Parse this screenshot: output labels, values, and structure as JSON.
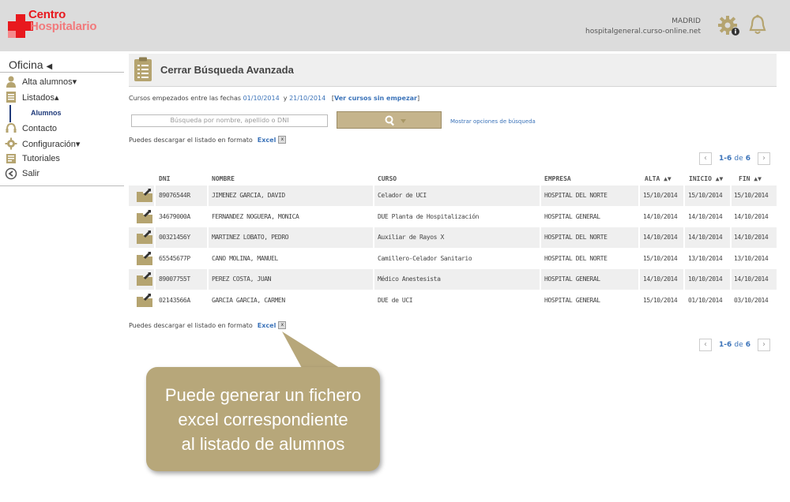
{
  "header": {
    "logo_line1": "Centro",
    "logo_line2": "Hospitalario",
    "city": "MADRID",
    "host": "hospitalgeneral.curso-online.net"
  },
  "sidebar": {
    "title": "Oficina",
    "title_arrow": "◀",
    "items": [
      {
        "label": "Alta alumnos▾",
        "icon": "user-icon"
      },
      {
        "label": "Listados▴",
        "icon": "list-icon"
      },
      {
        "label": "Contacto",
        "icon": "headset-icon"
      },
      {
        "label": "Configuración▾",
        "icon": "gear-icon"
      },
      {
        "label": "Tutoriales",
        "icon": "book-icon"
      },
      {
        "label": "Salir",
        "icon": "exit-icon"
      }
    ],
    "sub_item": "Alumnos"
  },
  "main": {
    "title": "Cerrar Búsqueda Avanzada",
    "dates": {
      "prefix": "Cursos empezados entre las fechas",
      "from": "01/10/2014",
      "and": "y",
      "to": "21/10/2014",
      "bracket_open": "[",
      "link": "Ver cursos sin empezar",
      "bracket_close": "]"
    },
    "search_placeholder": "Búsqueda por nombre, apellido o DNI",
    "search_options": "Mostrar opciones de búsqueda",
    "download_text": "Puedes descargar el listado en formato",
    "excel": "Excel",
    "pager": {
      "range": "1-6",
      "de": "de",
      "total": "6",
      "prev": "‹",
      "next": "›"
    }
  },
  "table": {
    "headers": {
      "dni": "DNI",
      "nombre": "NOMBRE",
      "curso": "CURSO",
      "empresa": "EMPRESA",
      "alta": "ALTA ▲▼",
      "inicio": "INICIO ▲▼",
      "fin": "FIN ▲▼"
    },
    "rows": [
      {
        "dni": "89076544R",
        "nombre": "JIMENEZ GARCIA, DAVID",
        "curso": "Celador de UCI",
        "empresa": "HOSPITAL DEL NORTE",
        "alta": "15/10/2014",
        "inicio": "15/10/2014",
        "fin": "15/10/2014"
      },
      {
        "dni": "34679000A",
        "nombre": "FERNANDEZ NOGUERA, MONICA",
        "curso": "DUE Planta de Hospitalización",
        "empresa": "HOSPITAL GENERAL",
        "alta": "14/10/2014",
        "inicio": "14/10/2014",
        "fin": "14/10/2014"
      },
      {
        "dni": "00321456Y",
        "nombre": "MARTINEZ LOBATO, PEDRO",
        "curso": "Auxiliar de Rayos X",
        "empresa": "HOSPITAL DEL NORTE",
        "alta": "14/10/2014",
        "inicio": "14/10/2014",
        "fin": "14/10/2014"
      },
      {
        "dni": "65545677P",
        "nombre": "CANO MOLINA, MANUEL",
        "curso": "Camillero-Celador Sanitario",
        "empresa": "HOSPITAL DEL NORTE",
        "alta": "15/10/2014",
        "inicio": "13/10/2014",
        "fin": "13/10/2014"
      },
      {
        "dni": "89007755T",
        "nombre": "PEREZ COSTA, JUAN",
        "curso": "Médico Anestesista",
        "empresa": "HOSPITAL GENERAL",
        "alta": "14/10/2014",
        "inicio": "10/10/2014",
        "fin": "14/10/2014"
      },
      {
        "dni": "02143566A",
        "nombre": "GARCIA GARCIA, CARMEN",
        "curso": "DUE de UCI",
        "empresa": "HOSPITAL GENERAL",
        "alta": "15/10/2014",
        "inicio": "01/10/2014",
        "fin": "03/10/2014"
      }
    ]
  },
  "callout": {
    "line1": "Puede generar un fichero",
    "line2": "excel correspondiente",
    "line3": "al listado de alumnos"
  },
  "colors": {
    "brand_red": "#e8191e",
    "link_blue": "#3b73b9",
    "callout_bg": "#b7a77a",
    "search_button": "#c5b48c"
  }
}
